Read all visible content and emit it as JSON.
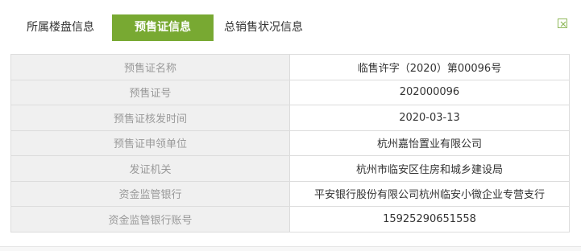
{
  "tabs": [
    {
      "label": "所属楼盘信息",
      "active": false
    },
    {
      "label": "预售证信息",
      "active": true
    },
    {
      "label": "总销售状况信息",
      "active": false
    }
  ],
  "close_icon": "close-icon",
  "accent_color": "#78a932",
  "rows": [
    {
      "label": "预售证名称",
      "value": "临售许字（2020）第00096号"
    },
    {
      "label": "预售证号",
      "value": "202000096"
    },
    {
      "label": "预售证核发时间",
      "value": "2020-03-13"
    },
    {
      "label": "预售证申领单位",
      "value": "杭州嘉怡置业有限公司"
    },
    {
      "label": "发证机关",
      "value": "杭州市临安区住房和城乡建设局"
    },
    {
      "label": "资金监管银行",
      "value": "平安银行股份有限公司杭州临安小微企业专营支行"
    },
    {
      "label": "资金监管银行账号",
      "value": "15925290651558"
    }
  ]
}
